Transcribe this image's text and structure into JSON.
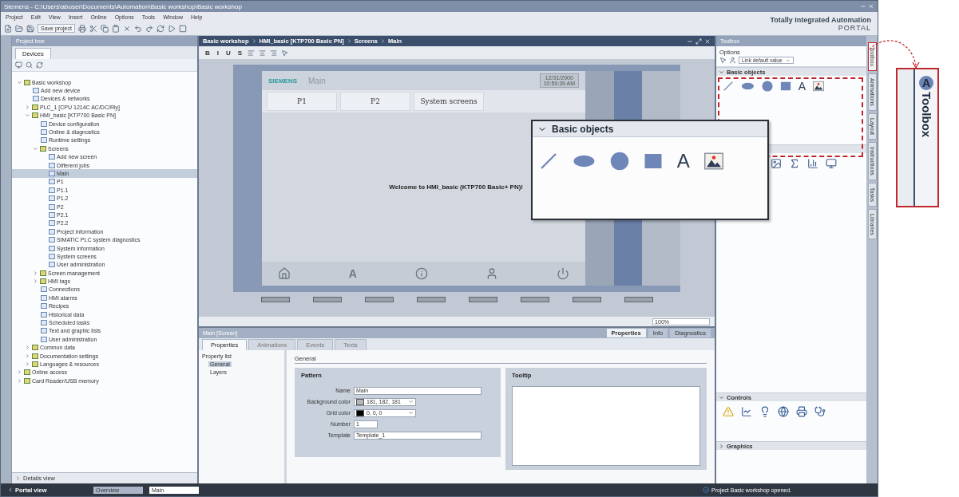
{
  "window": {
    "title": "Siemens - C:\\Users\\abuser\\Documents\\Automation\\Basic workshop\\Basic workshop"
  },
  "menu": [
    "Project",
    "Edit",
    "View",
    "Insert",
    "Online",
    "Options",
    "Tools",
    "Window",
    "Help"
  ],
  "toolbar": {
    "save_label": "Save project"
  },
  "brand": {
    "line1": "Totally Integrated Automation",
    "line2": "PORTAL"
  },
  "project_tree": {
    "title": "Project tree",
    "tabs": [
      {
        "label": "Devices",
        "selected": true
      }
    ],
    "items": [
      {
        "label": "Basic workshop",
        "expanded": true,
        "selected": false,
        "children": [
          {
            "label": "Add new device",
            "selected": false
          },
          {
            "label": "Devices & networks",
            "selected": false
          },
          {
            "label": "PLC_1 [CPU 1214C AC/DC/Rly]",
            "expanded": false,
            "selected": false
          },
          {
            "label": "HMI_basic [KTP700 Basic PN]",
            "expanded": true,
            "selected": false,
            "children": [
              {
                "label": "Device configuration",
                "selected": false
              },
              {
                "label": "Online & diagnostics",
                "selected": false
              },
              {
                "label": "Runtime settings",
                "selected": false
              },
              {
                "label": "Screens",
                "expanded": true,
                "selected": false,
                "children": [
                  {
                    "label": "Add new screen",
                    "selected": false
                  },
                  {
                    "label": "Different jobs",
                    "selected": false
                  },
                  {
                    "label": "Main",
                    "selected": true
                  },
                  {
                    "label": "P1",
                    "selected": false
                  },
                  {
                    "label": "P1.1",
                    "selected": false
                  },
                  {
                    "label": "P1.2",
                    "selected": false
                  },
                  {
                    "label": "P2",
                    "selected": false
                  },
                  {
                    "label": "P2.1",
                    "selected": false
                  },
                  {
                    "label": "P2.2",
                    "selected": false
                  },
                  {
                    "label": "Project information",
                    "selected": false
                  },
                  {
                    "label": "SIMATIC PLC system diagnostics",
                    "selected": false
                  },
                  {
                    "label": "System information",
                    "selected": false
                  },
                  {
                    "label": "System screens",
                    "selected": false
                  },
                  {
                    "label": "User administration",
                    "selected": false
                  }
                ]
              },
              {
                "label": "Screen management",
                "expanded": false,
                "selected": false
              },
              {
                "label": "HMI tags",
                "expanded": false,
                "selected": false
              },
              {
                "label": "Connections",
                "selected": false
              },
              {
                "label": "HMI alarms",
                "selected": false
              },
              {
                "label": "Recipes",
                "selected": false
              },
              {
                "label": "Historical data",
                "selected": false
              },
              {
                "label": "Scheduled tasks",
                "selected": false
              },
              {
                "label": "Text and graphic lists",
                "selected": false
              },
              {
                "label": "User administration",
                "selected": false
              }
            ]
          },
          {
            "label": "Common data",
            "expanded": false,
            "selected": false
          },
          {
            "label": "Documentation settings",
            "expanded": false,
            "selected": false
          },
          {
            "label": "Languages & resources",
            "expanded": false,
            "selected": false
          }
        ]
      },
      {
        "label": "Online access",
        "expanded": false,
        "selected": false
      },
      {
        "label": "Card Reader/USB memory",
        "expanded": false,
        "selected": false
      }
    ],
    "details": "Details view"
  },
  "editor": {
    "breadcrumb": [
      "Basic workshop",
      "HMI_basic [KTP700 Basic PN]",
      "Screens",
      "Main"
    ],
    "format_buttons": [
      "B",
      "I",
      "U",
      "S"
    ],
    "hmi": {
      "brand": "SIEMENS",
      "screen_title": "Main",
      "date": "12/31/2000",
      "time": "10:59:39 AM",
      "tabs": [
        "P1",
        "P2",
        "System screens"
      ],
      "welcome": "Welcome to HMI_basic (KTP700 Basic+ PN)!",
      "buttons": [
        {
          "kind": "home"
        },
        {
          "kind": "text",
          "glyph": "A"
        },
        {
          "kind": "info"
        },
        {
          "kind": "user"
        },
        {
          "kind": "power"
        }
      ]
    },
    "zoom": "100%"
  },
  "inspector": {
    "title": "Main [Screen]",
    "view_tabs": [
      {
        "label": "Properties",
        "selected": true
      },
      {
        "label": "Info",
        "selected": false
      },
      {
        "label": "Diagnostics",
        "selected": false
      }
    ],
    "tabs": [
      {
        "label": "Properties",
        "selected": true
      },
      {
        "label": "Animations",
        "selected": false
      },
      {
        "label": "Events",
        "selected": false
      },
      {
        "label": "Texts",
        "selected": false
      }
    ],
    "property_list": {
      "title": "Property list",
      "items": [
        {
          "label": "General",
          "selected": true
        },
        {
          "label": "Layers",
          "selected": false
        }
      ]
    },
    "section": "General",
    "pattern": {
      "title": "Pattern",
      "fields": [
        {
          "kind": "text",
          "label": "Name",
          "value": "Main"
        },
        {
          "kind": "color",
          "label": "Background color",
          "value": "181, 182, 181",
          "color": "#b5b6b5"
        },
        {
          "kind": "color",
          "label": "Grid color",
          "value": "0, 0, 0",
          "color": "#000000"
        },
        {
          "kind": "number",
          "label": "Number",
          "value": "1"
        },
        {
          "kind": "select",
          "label": "Template",
          "value": "Template_1"
        }
      ]
    },
    "tooltip": {
      "title": "Tooltip"
    }
  },
  "toolbox": {
    "title": "Toolbox",
    "options_title": "Options",
    "default_value": "Link default value",
    "sections": [
      {
        "kind": "basic",
        "title": "Basic objects",
        "expanded": true,
        "items": [
          {
            "kind": "line"
          },
          {
            "kind": "ellipse"
          },
          {
            "kind": "circle"
          },
          {
            "kind": "rectangle"
          },
          {
            "kind": "text",
            "glyph": "A"
          },
          {
            "kind": "image"
          }
        ]
      },
      {
        "kind": "elements"
      },
      {
        "kind": "controls",
        "title": "Controls",
        "expanded": true
      },
      {
        "kind": "graphics",
        "title": "Graphics",
        "expanded": false
      }
    ],
    "side_tabs": [
      {
        "label": "Toolbox",
        "selected": true
      },
      {
        "label": "Animations",
        "selected": false
      },
      {
        "label": "Layout",
        "selected": false
      },
      {
        "label": "Instructions",
        "selected": false
      },
      {
        "label": "Tasks",
        "selected": false
      },
      {
        "label": "Libraries",
        "selected": false
      }
    ]
  },
  "status_bar": {
    "portal_view": "Portal view",
    "tasks": [
      {
        "label": "Overview",
        "selected": false
      },
      {
        "label": "Main",
        "selected": true
      }
    ],
    "message": "Project Basic workshop opened."
  },
  "callouts": {
    "basic_objects": {
      "title": "Basic objects",
      "items": [
        {
          "kind": "line"
        },
        {
          "kind": "ellipse"
        },
        {
          "kind": "circle"
        },
        {
          "kind": "rectangle"
        },
        {
          "kind": "text",
          "glyph": "A"
        },
        {
          "kind": "image"
        }
      ]
    },
    "toolbox_tab": {
      "glyph": "A",
      "label": "Toolbox"
    }
  }
}
